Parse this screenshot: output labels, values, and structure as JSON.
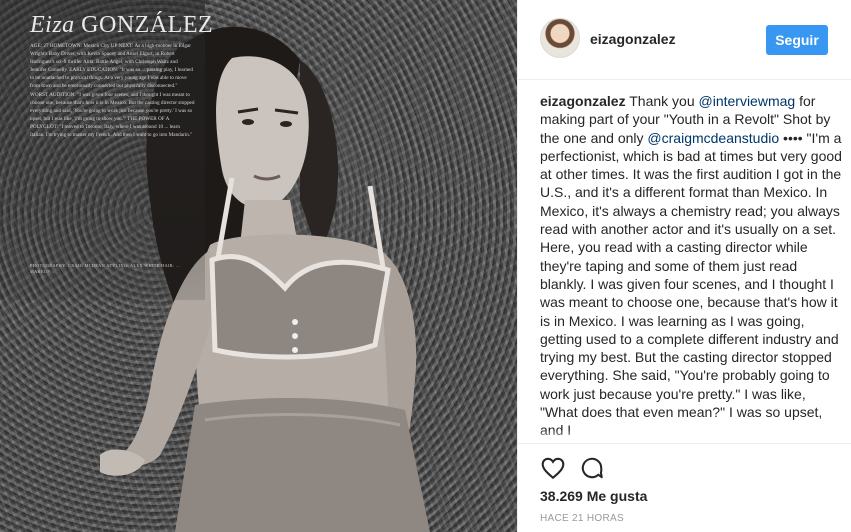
{
  "photo": {
    "mag_title_italic": "Eiza",
    "mag_title_caps": "GONZÁLEZ",
    "mag_body": "AGE: 27 HOMETOWN: Mexico City UP NEXT: As a high-mobber in Edgar Wright's Baby Driver, with Kevin Spacey and Ansel Elgort; in Robert Rodriguez's sci-fi thriller Alita: Battle Angel, with Christoph Waltz and Jennifer Connelly. EARLY EDUCATION: \"It was so ... passing play, I learned to be unattached to physical things. At a very young age I was able to move from town and be emotionally connected but physically disconnected.\" WORST AUDITION: \"I was given four scenes, and I thought I was meant to choose one, because that's how it is in Mexico. But the casting director stopped everything and said, 'You're going to work just because you're pretty.' I was so upset, but I was like, 'I'm going to show you.'\" THE POWER OF A POLYGLOT: \"I moved to Toronto, Italy, where I was around 10 ... learn Italian. I'm trying to master my French. And then I want to go into Mandarin.\"",
    "mag_credit": "PHOTOGRAPHY: CRAIG MCDEAN STYLING: ALEX WHITE HAIR: ... MAKEUP: ..."
  },
  "header": {
    "username": "eizagonzalez",
    "follow_label": "Seguir"
  },
  "caption": {
    "username": "eizagonzalez",
    "text1": " Thank you ",
    "mention1": "@interviewmag",
    "text2": " for making part of your \"Youth in a Revolt\" Shot by the one and only ",
    "mention2": "@craigmcdeanstudio",
    "text3": " •••• \"I'm a perfectionist, which is bad at times but very good at other times. It was the first audition I got in the U.S., and it's a different format than Mexico. In Mexico, it's always a chemistry read; you always read with another actor and it's usually on a set. Here, you read with a casting director while they're taping and some of them just read blankly. I was given four scenes, and I thought I was meant to choose one, because that's how it is in Mexico. I was learning as I was going, getting used to a complete different industry and trying my best. But the casting director stopped everything. She said, \"You're probably going to work just because you're pretty.\" I was like, \"What does that even mean?\" I was so upset, and I"
  },
  "actions": {
    "like_icon": "heart-icon",
    "comment_icon": "comment-icon",
    "likes": "38.269 Me gusta",
    "time": "HACE 21 HORAS"
  },
  "colors": {
    "follow_bg": "#3897f0",
    "mention": "#003569",
    "text": "#262626",
    "muted": "#999999"
  }
}
